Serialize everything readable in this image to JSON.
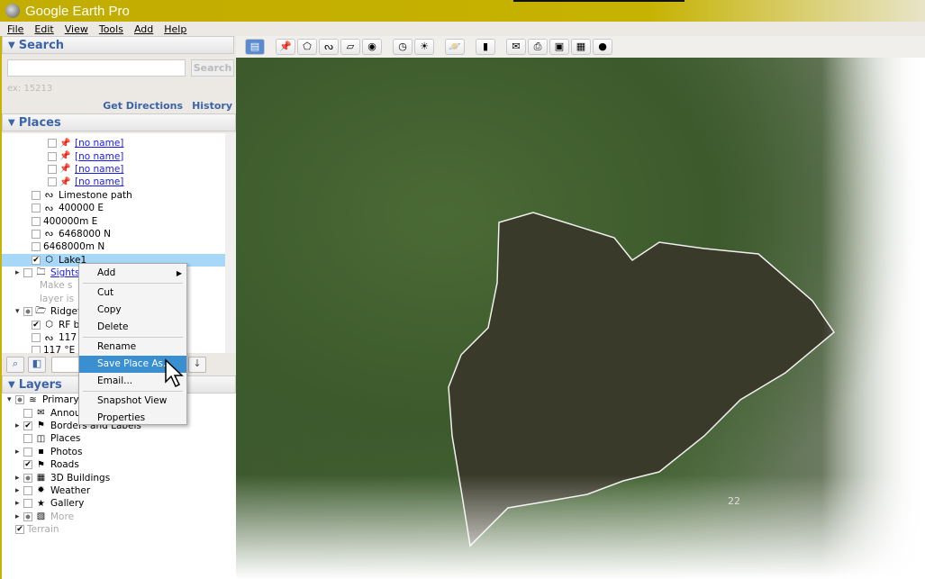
{
  "window": {
    "title": "Google Earth Pro"
  },
  "menu": [
    "File",
    "Edit",
    "View",
    "Tools",
    "Add",
    "Help"
  ],
  "search": {
    "header": "Search",
    "placeholder": "",
    "button": "Search",
    "example": "ex: 15213",
    "get_directions": "Get Directions",
    "history": "History"
  },
  "places": {
    "header": "Places",
    "items": [
      {
        "label": "[no name]",
        "indent": 4,
        "check": "",
        "icon": "pushpin-icon",
        "link": true
      },
      {
        "label": "[no name]",
        "indent": 4,
        "check": "",
        "icon": "pushpin-icon",
        "link": true
      },
      {
        "label": "[no name]",
        "indent": 4,
        "check": "",
        "icon": "pushpin-icon",
        "link": true
      },
      {
        "label": "[no name]",
        "indent": 4,
        "check": "",
        "icon": "pushpin-icon",
        "link": true
      },
      {
        "label": "Limestone path",
        "indent": 2,
        "check": "",
        "icon": "path-icon"
      },
      {
        "label": "400000 E",
        "indent": 2,
        "check": "",
        "icon": "path-icon"
      },
      {
        "label": "400000m E",
        "indent": 2,
        "check": "",
        "icon": ""
      },
      {
        "label": "6468000 N",
        "indent": 2,
        "check": "",
        "icon": "path-icon"
      },
      {
        "label": "6468000m N",
        "indent": 2,
        "check": "",
        "icon": ""
      },
      {
        "label": "Lake1",
        "indent": 2,
        "check": "✔",
        "icon": "polygon-icon",
        "selected": true
      },
      {
        "label": "Sightse",
        "indent": 1,
        "check": "",
        "icon": "folder-icon",
        "link": true,
        "expander": "▸"
      },
      {
        "label": "Make s",
        "indent": 3,
        "grey": true
      },
      {
        "label": "layer is",
        "indent": 3,
        "grey": true
      },
      {
        "label": "Ridgefi",
        "indent": 1,
        "check": "p",
        "icon": "folder-open-icon",
        "expander": "▾"
      },
      {
        "label": "RF b",
        "indent": 2,
        "check": "✔",
        "icon": "polygon-icon"
      },
      {
        "label": "117 °",
        "indent": 2,
        "check": "",
        "icon": "path-icon"
      },
      {
        "label": "117 °E",
        "indent": 2,
        "check": "",
        "icon": ""
      }
    ]
  },
  "layers": {
    "header": "Layers",
    "items": [
      {
        "label": "Primary D",
        "indent": 0,
        "check": "p",
        "icon": "layers-icon",
        "expander": "▾"
      },
      {
        "label": "Announ",
        "indent": 1,
        "check": "",
        "icon": "envelope-icon"
      },
      {
        "label": "Borders and Labels",
        "indent": 1,
        "check": "✔",
        "icon": "flag-icon",
        "expander": "▸"
      },
      {
        "label": "Places",
        "indent": 1,
        "check": "",
        "icon": "places-icon"
      },
      {
        "label": "Photos",
        "indent": 1,
        "check": "",
        "icon": "photo-icon",
        "expander": "▸"
      },
      {
        "label": "Roads",
        "indent": 1,
        "check": "✔",
        "icon": "flag-icon"
      },
      {
        "label": "3D Buildings",
        "indent": 1,
        "check": "p",
        "icon": "buildings-icon",
        "expander": "▸"
      },
      {
        "label": "Weather",
        "indent": 1,
        "check": "",
        "icon": "sun-icon",
        "expander": "▸"
      },
      {
        "label": "Gallery",
        "indent": 1,
        "check": "",
        "icon": "star-icon",
        "expander": "▸"
      },
      {
        "label": "More",
        "indent": 1,
        "check": "p",
        "icon": "note-icon",
        "expander": "▸",
        "grey": true
      },
      {
        "label": "Terrain",
        "indent": 0,
        "check": "✔",
        "icon": "",
        "grey": true
      }
    ]
  },
  "context_menu": {
    "items": [
      "Add",
      "Cut",
      "Copy",
      "Delete",
      "Rename",
      "Save Place As...",
      "Email...",
      "Snapshot View",
      "Properties"
    ],
    "highlighted": "Save Place As..."
  },
  "map": {
    "label": "22"
  },
  "colors": {
    "title_bar": "#c4b000",
    "accent": "#3c64a8",
    "selection": "#a8d8f8",
    "menu_highlight": "#3a8fd0"
  }
}
